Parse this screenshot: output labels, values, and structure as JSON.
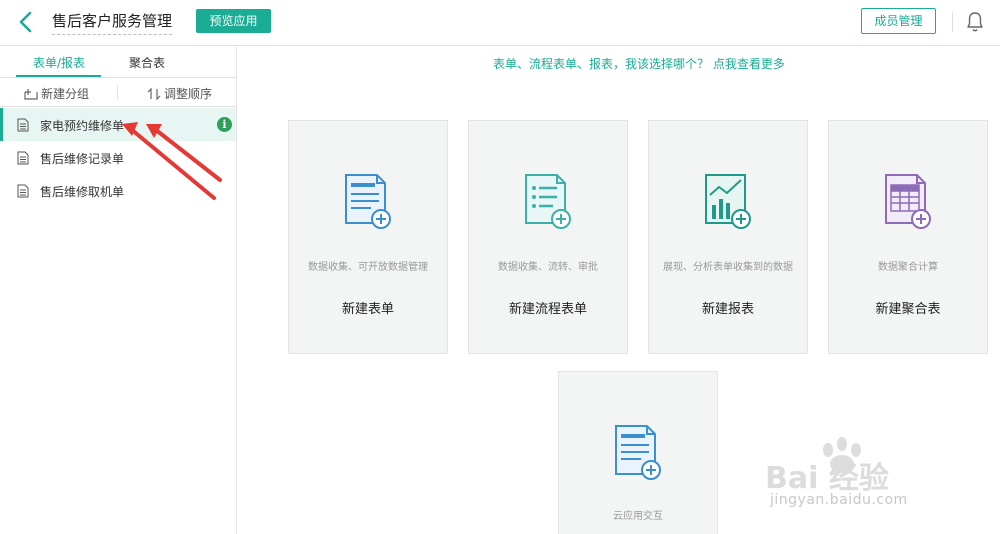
{
  "header": {
    "title": "售后客户服务管理",
    "preview_label": "预览应用",
    "members_label": "成员管理"
  },
  "sidebar": {
    "tabs": [
      {
        "label": "表单/报表",
        "active": true
      },
      {
        "label": "聚合表",
        "active": false
      }
    ],
    "actions": {
      "new_group": "新建分组",
      "reorder": "调整顺序"
    },
    "items": [
      {
        "label": "家电预约维修单",
        "active": true,
        "badge": "i"
      },
      {
        "label": "售后维修记录单",
        "active": false
      },
      {
        "label": "售后维修取机单",
        "active": false
      }
    ]
  },
  "main": {
    "hint": "表单、流程表单、报表，我该选择哪个？ 点我查看更多",
    "cards": [
      {
        "desc": "数据收集、可开放数据管理",
        "title": "新建表单",
        "icon": "form-doc-icon"
      },
      {
        "desc": "数据收集、流转、审批",
        "title": "新建流程表单",
        "icon": "flow-form-icon"
      },
      {
        "desc": "展现、分析表单收集到的数据",
        "title": "新建报表",
        "icon": "report-chart-icon"
      },
      {
        "desc": "数据聚合计算",
        "title": "新建聚合表",
        "icon": "aggregate-table-icon"
      },
      {
        "desc": "云应用交互",
        "title": "",
        "icon": "cloud-app-icon"
      }
    ]
  },
  "watermark": {
    "brand": "Bai 经验",
    "url": "jingyan.baidu.com"
  },
  "colors": {
    "accent": "#1aac95",
    "form_icon": "#3b8fd0",
    "flow_icon": "#3bb0a8",
    "report_icon": "#1f9a8a",
    "aggregate_icon": "#8d6bb8",
    "arrow": "#e53935"
  }
}
